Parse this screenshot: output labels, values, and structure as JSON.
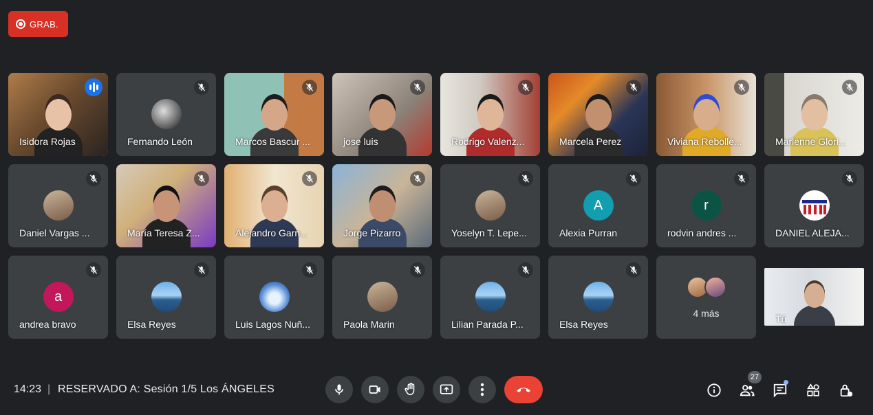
{
  "recording": {
    "label": "GRAB.",
    "color": "#d93025"
  },
  "meeting": {
    "time": "14:23",
    "separator": "|",
    "title": "RESERVADO A: Sesión 1/5 Los ÁNGELES"
  },
  "participants_badge": "27",
  "more_tile": {
    "label": "4 más"
  },
  "self_tile": {
    "name": "Tú"
  },
  "tiles": [
    {
      "name": "Isidora Rojas",
      "kind": "video",
      "speaking": true
    },
    {
      "name": "Fernando León",
      "kind": "avatar",
      "avatar_style": "bw"
    },
    {
      "name": "Marcos Bascur ...",
      "kind": "video"
    },
    {
      "name": "jose luis",
      "kind": "video"
    },
    {
      "name": "Rodrigo Valenz...",
      "kind": "video"
    },
    {
      "name": "Marcela Perez",
      "kind": "video"
    },
    {
      "name": "Viviana Rebolle...",
      "kind": "video"
    },
    {
      "name": "Marlenne Glori...",
      "kind": "video"
    },
    {
      "name": "Daniel Vargas ...",
      "kind": "avatar",
      "avatar_style": "photo"
    },
    {
      "name": "María Teresa Z...",
      "kind": "video"
    },
    {
      "name": "Alejandro Garn...",
      "kind": "video"
    },
    {
      "name": "Jorge Pizarro",
      "kind": "video"
    },
    {
      "name": "Yoselyn T. Lepe...",
      "kind": "avatar",
      "avatar_style": "photo"
    },
    {
      "name": "Alexia Purran",
      "kind": "avatar",
      "letter": "A",
      "avatar_color": "#129eaf"
    },
    {
      "name": "rodvin andres ...",
      "kind": "avatar",
      "letter": "r",
      "avatar_color": "#0b5345"
    },
    {
      "name": "DANIEL ALEJA...",
      "kind": "avatar",
      "avatar_style": "logo"
    },
    {
      "name": "andrea bravo",
      "kind": "avatar",
      "letter": "a",
      "avatar_color": "#c2185b"
    },
    {
      "name": "Elsa Reyes",
      "kind": "avatar",
      "avatar_style": "lake"
    },
    {
      "name": "Luis Lagos Nuñ...",
      "kind": "avatar",
      "avatar_style": "wolf"
    },
    {
      "name": "Paola Marin",
      "kind": "avatar",
      "avatar_style": "photo"
    },
    {
      "name": "Lilian Parada P...",
      "kind": "avatar",
      "avatar_style": "lake"
    },
    {
      "name": "Elsa Reyes",
      "kind": "avatar",
      "avatar_style": "lake"
    }
  ],
  "controls": {
    "left": [
      "mic-icon",
      "camera-icon",
      "raise-hand-icon",
      "present-screen-icon",
      "more-options-icon",
      "hang-up-icon"
    ],
    "right": [
      "info-icon",
      "people-icon",
      "chat-icon",
      "activities-icon",
      "host-controls-icon"
    ]
  }
}
